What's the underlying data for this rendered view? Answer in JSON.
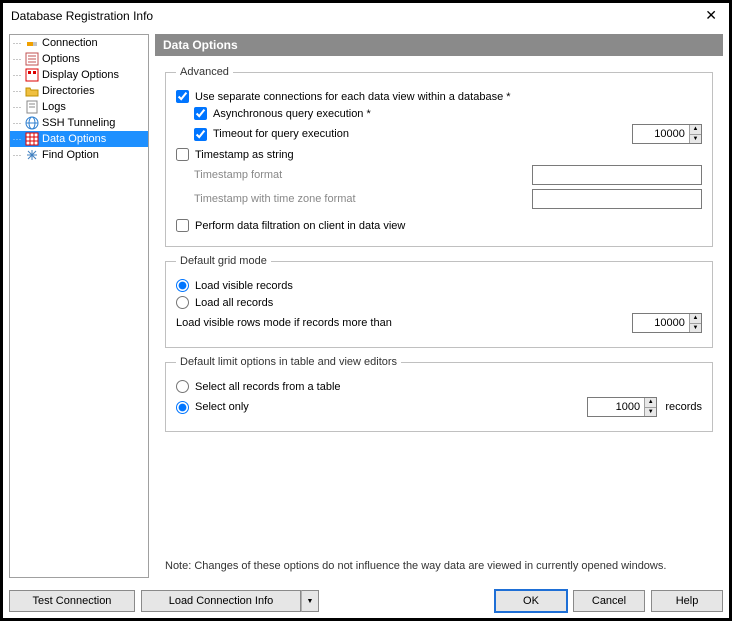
{
  "window": {
    "title": "Database Registration Info"
  },
  "sidebar": {
    "items": [
      {
        "label": "Connection"
      },
      {
        "label": "Options"
      },
      {
        "label": "Display Options"
      },
      {
        "label": "Directories"
      },
      {
        "label": "Logs"
      },
      {
        "label": "SSH Tunneling"
      },
      {
        "label": "Data Options"
      },
      {
        "label": "Find Option"
      }
    ]
  },
  "main": {
    "header": "Data Options",
    "advanced": {
      "legend": "Advanced",
      "use_separate": "Use separate connections for each data view within a database *",
      "async_query": "Asynchronous query execution *",
      "timeout_label": "Timeout for query execution",
      "timeout_value": "10000",
      "timestamp_as_string": "Timestamp as string",
      "timestamp_format": "Timestamp format",
      "timestamp_tz_format": "Timestamp with time zone format",
      "perform_filtration": "Perform data filtration on client in data view"
    },
    "grid": {
      "legend": "Default grid mode",
      "load_visible": "Load visible records",
      "load_all": "Load all records",
      "threshold_label": "Load visible rows mode if records more than",
      "threshold_value": "10000"
    },
    "limit": {
      "legend": "Default limit options in table and view editors",
      "select_all": "Select all records from a table",
      "select_only": "Select only",
      "select_only_value": "1000",
      "records": "records"
    },
    "note": "Note: Changes of these options do not influence the way data are viewed in currently opened windows."
  },
  "footer": {
    "test": "Test Connection",
    "load": "Load Connection Info",
    "ok": "OK",
    "cancel": "Cancel",
    "help": "Help"
  }
}
